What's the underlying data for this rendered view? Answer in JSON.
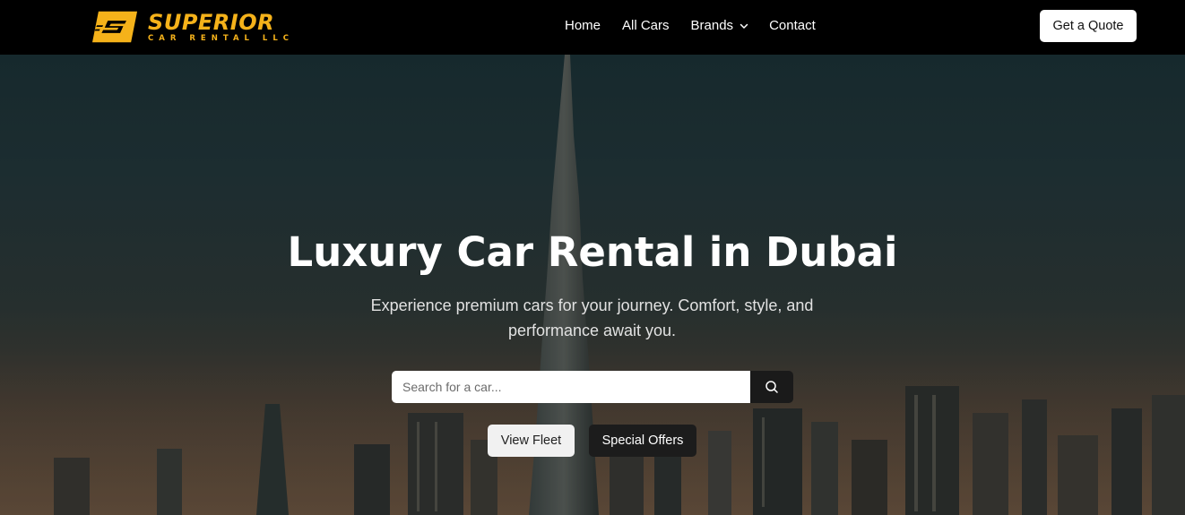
{
  "brand": {
    "name": "SUPERIOR",
    "tagline": "CAR RENTAL LLC",
    "color": "#f5b21a"
  },
  "nav": {
    "items": [
      {
        "label": "Home"
      },
      {
        "label": "All Cars"
      },
      {
        "label": "Brands",
        "has_dropdown": true
      },
      {
        "label": "Contact"
      }
    ],
    "cta_label": "Get a Quote"
  },
  "hero": {
    "title": "Luxury Car Rental in Dubai",
    "subtitle": "Experience premium cars for your journey. Comfort, style, and performance await you.",
    "search": {
      "placeholder": "Search for a car...",
      "value": "",
      "icon": "search-icon"
    },
    "primary_button": "View Fleet",
    "secondary_button": "Special Offers"
  }
}
